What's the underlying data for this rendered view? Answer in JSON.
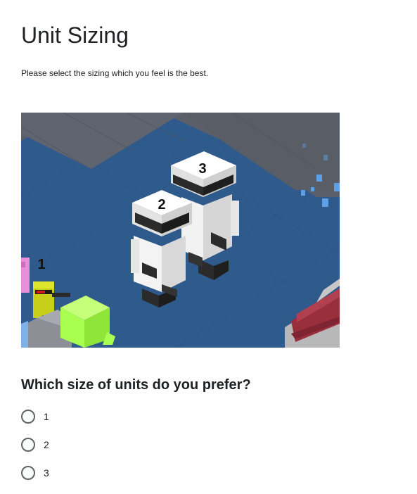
{
  "form": {
    "title": "Unit Sizing",
    "description": "Please select the sizing which you feel is the best."
  },
  "image": {
    "unit_labels": [
      "1",
      "2",
      "3"
    ],
    "colors": {
      "water": "#2f5a8c",
      "stone": "#5b5f69",
      "suit": "#f4f4f4",
      "visor": "#2b2b2b",
      "lime": "#a9ff4f",
      "yellow_unit": "#c8cf1a",
      "pink_unit": "#e88fdb",
      "brick": "#9a2f3c",
      "crystal": "#5f9fe6"
    }
  },
  "question": {
    "text": "Which size of units do you prefer?",
    "options": [
      {
        "label": "1"
      },
      {
        "label": "2"
      },
      {
        "label": "3"
      }
    ]
  }
}
